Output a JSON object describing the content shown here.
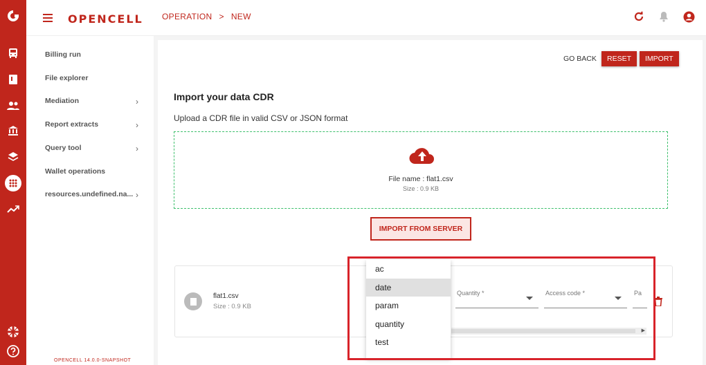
{
  "app": {
    "brand": "OPENCELL",
    "footer_text": "OPENCELL 14.0.0-SNAPSHOT"
  },
  "breadcrumb": {
    "items": [
      "OPERATION",
      "NEW"
    ],
    "separator": ">"
  },
  "header_icons": [
    "refresh-icon",
    "bell-icon",
    "account-icon"
  ],
  "rail_icons": [
    "logo-icon",
    "bus-icon",
    "book-icon",
    "users-icon",
    "bank-icon",
    "layers-icon",
    "mediation-icon",
    "trending-up-icon",
    "flag-uk-icon",
    "help-icon"
  ],
  "sidenav": {
    "items": [
      {
        "label": "Billing run",
        "chevron": ""
      },
      {
        "label": "File explorer",
        "chevron": ""
      },
      {
        "label": "Mediation",
        "chevron": "›"
      },
      {
        "label": "Report extracts",
        "chevron": "›"
      },
      {
        "label": "Query tool",
        "chevron": "›"
      },
      {
        "label": "Wallet operations",
        "chevron": ""
      },
      {
        "label": "resources.undefined.na...",
        "chevron": "›"
      }
    ]
  },
  "toolbar": {
    "go_back": "GO BACK",
    "reset": "RESET",
    "import": "IMPORT"
  },
  "page": {
    "title": "Import your data CDR",
    "subtitle": "Upload a CDR file in valid CSV or JSON format"
  },
  "dropzone": {
    "file_name": "File name : flat1.csv",
    "file_size": "Size : 0.9 KB"
  },
  "import_from_server": "IMPORT FROM SERVER",
  "file_card": {
    "name": "flat1.csv",
    "size": "Size : 0.9 KB",
    "fields": [
      {
        "label": "Quantity *"
      },
      {
        "label": "Access code *"
      },
      {
        "label": "Pa"
      }
    ]
  },
  "dropdown": {
    "options": [
      "ac",
      "date",
      "param",
      "quantity",
      "test"
    ],
    "selected_index": 1
  },
  "colors": {
    "brand": "#c0261c",
    "dropzone_border": "#3bbf6a",
    "highlight": "#d8232a"
  }
}
